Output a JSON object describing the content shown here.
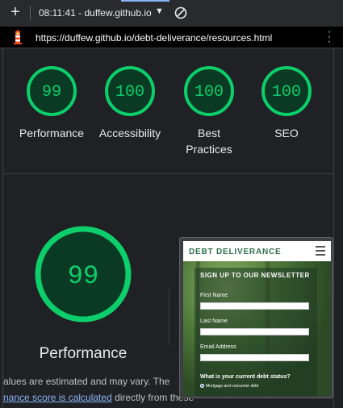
{
  "browser": {
    "title": "08:11:41 - duffew.github.io",
    "url": "https://duffew.github.io/debt-deliverance/resources.html"
  },
  "colors": {
    "pass": "#0cce6b",
    "pass_fill": "#0a3a23",
    "link": "#8ab4f8"
  },
  "categories": [
    {
      "score": "99",
      "label": "Performance"
    },
    {
      "score": "100",
      "label": "Accessibility"
    },
    {
      "score": "100",
      "label": "Best Practices"
    },
    {
      "score": "100",
      "label": "SEO"
    }
  ],
  "performance": {
    "score": "99",
    "label": "Performance",
    "note_line1": "alues are estimated and may vary. The",
    "note_link": "nance score is calculated",
    "note_line2_tail": " directly from these"
  },
  "screenshot": {
    "brand": "DEBT DELIVERANCE",
    "heading": "SIGN UP TO OUR NEWSLETTER",
    "first_name": "First Name",
    "last_name": "Last Name",
    "email": "Email Address",
    "question": "What is your current debt status?",
    "option": "Mortgage and consumer debt"
  },
  "icons": {
    "new_tab": "plus-icon",
    "dropdown": "caret-down-icon",
    "block": "no-entry-icon",
    "lighthouse": "lighthouse-icon",
    "menu": "kebab-menu-icon",
    "hamburger": "hamburger-icon"
  }
}
